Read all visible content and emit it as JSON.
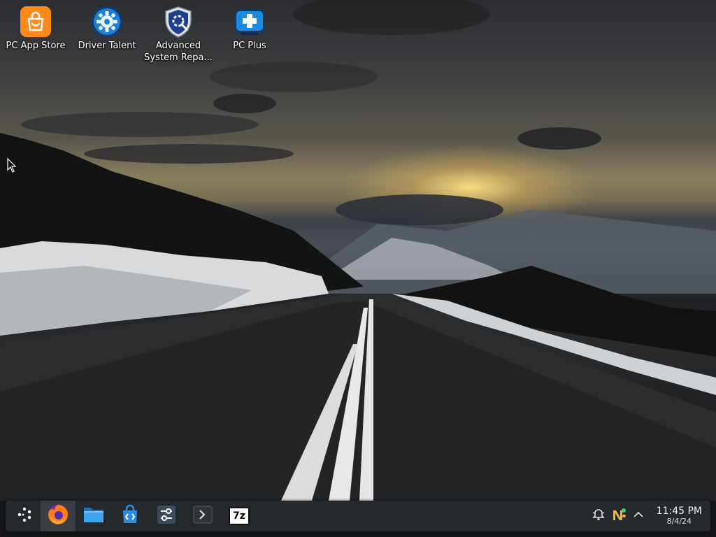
{
  "desktop": {
    "icons": [
      {
        "label": "PC App Store",
        "icon": "shopping-bag-icon"
      },
      {
        "label": "Driver Talent",
        "icon": "gear-icon"
      },
      {
        "label": "Advanced System Repa...",
        "icon": "shield-gear-icon"
      },
      {
        "label": "PC Plus",
        "icon": "medical-cross-icon"
      }
    ]
  },
  "taskbar": {
    "apps": [
      {
        "icon": "app-launcher-icon"
      },
      {
        "icon": "firefox-icon"
      },
      {
        "icon": "file-manager-icon"
      },
      {
        "icon": "software-store-icon"
      },
      {
        "icon": "settings-sliders-icon"
      },
      {
        "icon": "terminal-icon"
      },
      {
        "icon": "7zip-icon",
        "text": "7z"
      }
    ],
    "tray": {
      "icons": [
        "notifications-bell-icon",
        "update-manager-icon",
        "expand-tray-chevron-icon"
      ]
    },
    "clock": {
      "time": "11:45 PM",
      "date": "8/4/24"
    }
  },
  "colors": {
    "taskbar_bg": "#25282c",
    "accent_orange": "#ff8a1a",
    "accent_blue": "#2a7fd6"
  }
}
